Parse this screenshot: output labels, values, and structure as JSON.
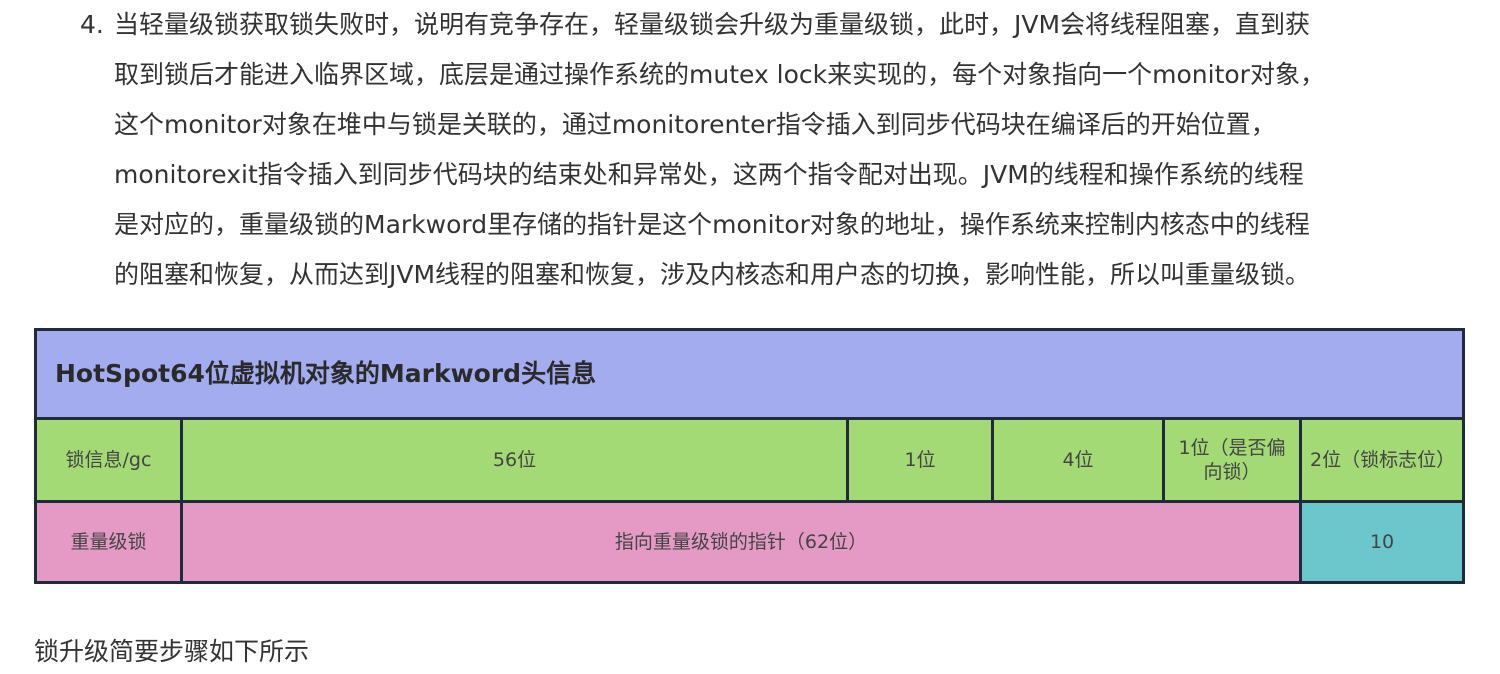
{
  "list_item": {
    "number": "4.",
    "lines": [
      "当轻量级锁获取锁失败时，说明有竞争存在，轻量级锁会升级为重量级锁，此时，JVM会将线程阻塞，直到获",
      "取到锁后才能进入临界区域，底层是通过操作系统的mutex lock来实现的，每个对象指向一个monitor对象，",
      "这个monitor对象在堆中与锁是关联的，通过monitorenter指令插入到同步代码块在编译后的开始位置，",
      "monitorexit指令插入到同步代码块的结束处和异常处，这两个指令配对出现。JVM的线程和操作系统的线程",
      "是对应的，重量级锁的Markword里存储的指针是这个monitor对象的地址，操作系统来控制内核态中的线程",
      "的阻塞和恢复，从而达到JVM线程的阻塞和恢复，涉及内核态和用户态的切换，影响性能，所以叫重量级锁。"
    ]
  },
  "table": {
    "title": "HotSpot64位虚拟机对象的Markword头信息",
    "header": [
      "锁信息/gc",
      "56位",
      "1位",
      "4位",
      "1位（是否偏向锁）",
      "2位（锁标志位）"
    ],
    "heavy_row": {
      "label": "重量级锁",
      "pointer": "指向重量级锁的指针（62位）",
      "flag": "10"
    },
    "colors": {
      "title_bg": "#a3acee",
      "header_bg": "#a3da75",
      "heavy_bg": "#e59ac5",
      "flag_bg": "#6cc7cc",
      "border": "#1f2a3a"
    }
  },
  "footer": {
    "text": "锁升级简要步骤如下所示"
  }
}
